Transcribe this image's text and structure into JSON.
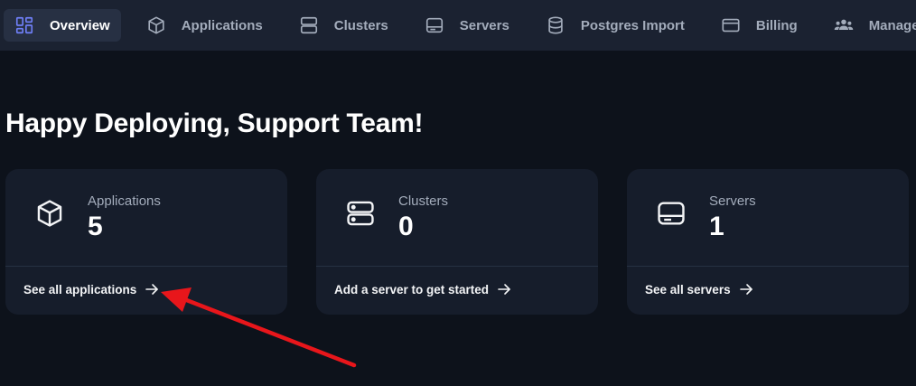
{
  "nav": {
    "items": [
      {
        "label": "Overview",
        "icon": "grid-icon",
        "active": true
      },
      {
        "label": "Applications",
        "icon": "cube-icon"
      },
      {
        "label": "Clusters",
        "icon": "server-stack-icon"
      },
      {
        "label": "Servers",
        "icon": "hard-drive-icon"
      },
      {
        "label": "Postgres Import",
        "icon": "database-icon"
      },
      {
        "label": "Billing",
        "icon": "credit-card-icon"
      },
      {
        "label": "Manage T",
        "icon": "users-icon"
      }
    ]
  },
  "greeting": "Happy Deploying, Support Team!",
  "cards": [
    {
      "label": "Applications",
      "value": "5",
      "link": "See all applications",
      "icon": "cube-icon"
    },
    {
      "label": "Clusters",
      "value": "0",
      "link": "Add a server to get started",
      "icon": "server-stack-icon"
    },
    {
      "label": "Servers",
      "value": "1",
      "link": "See all servers",
      "icon": "hard-drive-icon"
    }
  ],
  "colors": {
    "background": "#0d121b",
    "nav_background": "#1b2231",
    "card_background": "#161d2b",
    "active_icon": "#6f7ff7",
    "annotation": "#e8161b"
  }
}
